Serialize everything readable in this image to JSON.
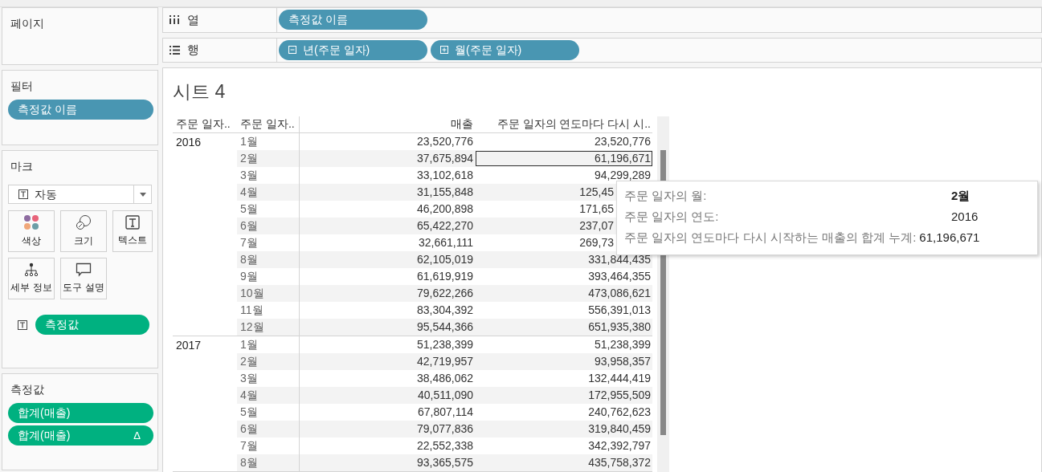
{
  "pages_shelf": {
    "title": "페이지"
  },
  "filters_shelf": {
    "title": "필터",
    "pills": [
      {
        "label": "측정값 이름",
        "kind": "dimension"
      }
    ]
  },
  "marks_card": {
    "title": "마크",
    "mark_type": "자동",
    "buttons": [
      {
        "label": "색상",
        "kind": "color"
      },
      {
        "label": "크기",
        "kind": "size"
      },
      {
        "label": "텍스트",
        "kind": "text"
      },
      {
        "label": "세부 정보",
        "kind": "detail"
      },
      {
        "label": "도구 설명",
        "kind": "tooltip"
      }
    ],
    "pills": [
      {
        "label": "측정값",
        "kind": "measure"
      }
    ]
  },
  "measure_values": {
    "title": "측정값",
    "pills": [
      {
        "label": "합계(매출)",
        "kind": "measure"
      },
      {
        "label": "합계(매출)",
        "kind": "measure",
        "badge": "Δ"
      }
    ]
  },
  "columns_shelf": {
    "label": "열",
    "pills": [
      {
        "label": "측정값 이름",
        "kind": "dimension"
      }
    ]
  },
  "rows_shelf": {
    "label": "행",
    "pills": [
      {
        "label": "년(주문 일자)",
        "kind": "dimension",
        "expanded": true
      },
      {
        "label": "월(주문 일자)",
        "kind": "dimension",
        "expanded": false
      }
    ]
  },
  "sheet": {
    "title": "시트 4",
    "columns": [
      "주문 일자..",
      "주문 일자..",
      "매출",
      "주문 일자의 연도마다 다시 시.."
    ],
    "groups": [
      {
        "year": "2016",
        "rows": [
          {
            "month": "1월",
            "sales": "23,520,776",
            "running_total": "23,520,776",
            "selected": false,
            "covered": false
          },
          {
            "month": "2월",
            "sales": "37,675,894",
            "running_total": "61,196,671",
            "selected": true,
            "covered": false
          },
          {
            "month": "3월",
            "sales": "33,102,618",
            "running_total": "94,299,289",
            "selected": false,
            "covered": false
          },
          {
            "month": "4월",
            "sales": "31,155,848",
            "running_total": "125,45",
            "selected": false,
            "covered": true
          },
          {
            "month": "5월",
            "sales": "46,200,898",
            "running_total": "171,65",
            "selected": false,
            "covered": true
          },
          {
            "month": "6월",
            "sales": "65,422,270",
            "running_total": "237,07",
            "selected": false,
            "covered": true
          },
          {
            "month": "7월",
            "sales": "32,661,111",
            "running_total": "269,73",
            "selected": false,
            "covered": true
          },
          {
            "month": "8월",
            "sales": "62,105,019",
            "running_total": "331,844,435",
            "selected": false,
            "covered": false
          },
          {
            "month": "9월",
            "sales": "61,619,919",
            "running_total": "393,464,355",
            "selected": false,
            "covered": false
          },
          {
            "month": "10월",
            "sales": "79,622,266",
            "running_total": "473,086,621",
            "selected": false,
            "covered": false
          },
          {
            "month": "11월",
            "sales": "83,304,392",
            "running_total": "556,391,013",
            "selected": false,
            "covered": false
          },
          {
            "month": "12월",
            "sales": "95,544,366",
            "running_total": "651,935,380",
            "selected": false,
            "covered": false
          }
        ]
      },
      {
        "year": "2017",
        "rows": [
          {
            "month": "1월",
            "sales": "51,238,399",
            "running_total": "51,238,399",
            "selected": false,
            "covered": false
          },
          {
            "month": "2월",
            "sales": "42,719,957",
            "running_total": "93,958,357",
            "selected": false,
            "covered": false
          },
          {
            "month": "3월",
            "sales": "38,486,062",
            "running_total": "132,444,419",
            "selected": false,
            "covered": false
          },
          {
            "month": "4월",
            "sales": "40,511,090",
            "running_total": "172,955,509",
            "selected": false,
            "covered": false
          },
          {
            "month": "5월",
            "sales": "67,807,114",
            "running_total": "240,762,623",
            "selected": false,
            "covered": false
          },
          {
            "month": "6월",
            "sales": "79,077,836",
            "running_total": "319,840,459",
            "selected": false,
            "covered": false
          },
          {
            "month": "7월",
            "sales": "22,552,338",
            "running_total": "342,392,797",
            "selected": false,
            "covered": false
          },
          {
            "month": "8월",
            "sales": "93,365,575",
            "running_total": "435,758,372",
            "selected": false,
            "covered": false
          }
        ]
      }
    ]
  },
  "tooltip": {
    "lines": [
      {
        "label": "주문 일자의 월:",
        "value": "2월",
        "bold": true
      },
      {
        "label": "주문 일자의 연도:",
        "value": "2016",
        "bold": false
      },
      {
        "label": "주문 일자의 연도마다 다시 시작하는 매출의 합계 누계:",
        "value": "61,196,671",
        "bold": false
      }
    ]
  }
}
